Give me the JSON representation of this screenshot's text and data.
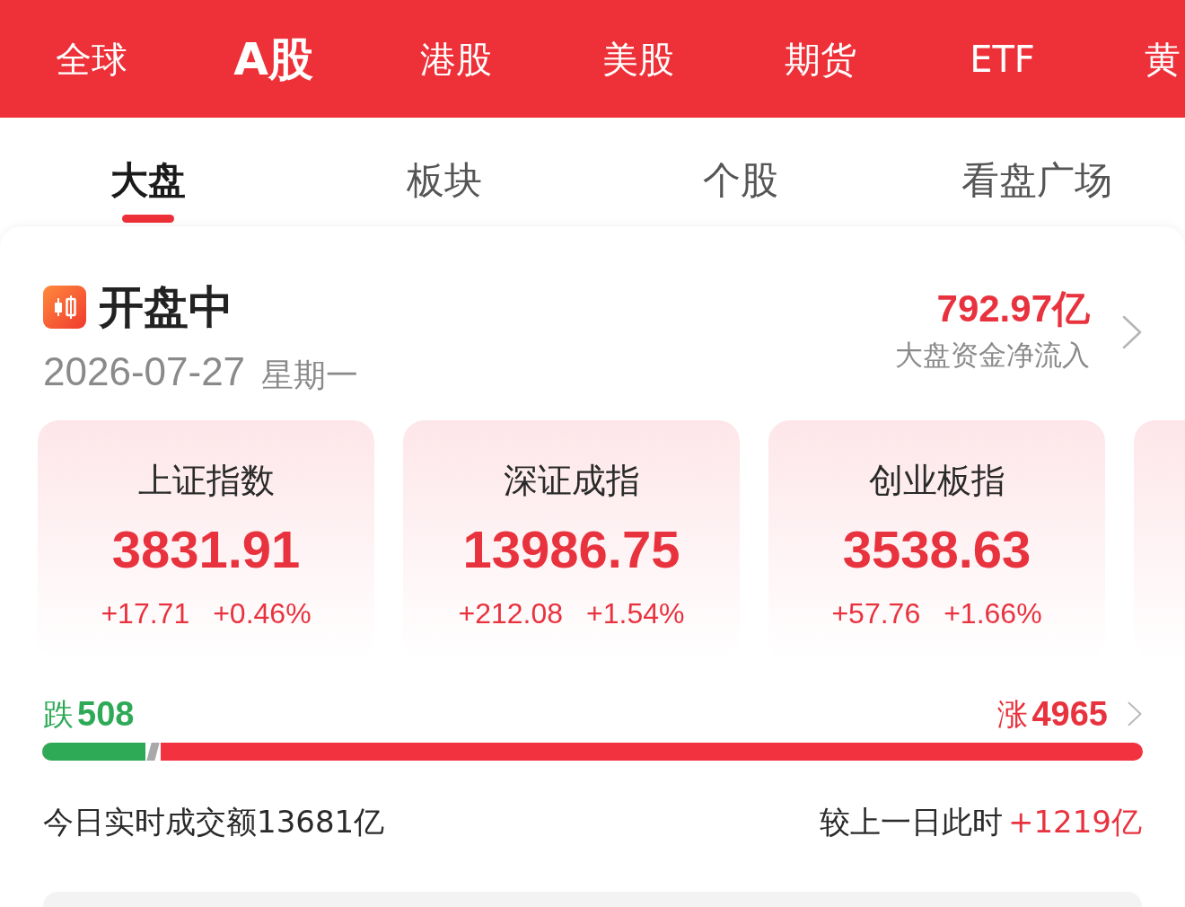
{
  "market_tabs": [
    {
      "label": "全球",
      "selected": false
    },
    {
      "label": "A股",
      "selected": true
    },
    {
      "label": "港股",
      "selected": false
    },
    {
      "label": "美股",
      "selected": false
    },
    {
      "label": "期货",
      "selected": false
    },
    {
      "label": "ETF",
      "selected": false
    },
    {
      "label": "黄",
      "selected": false
    }
  ],
  "view_tabs": [
    {
      "label": "大盘",
      "selected": true
    },
    {
      "label": "板块",
      "selected": false
    },
    {
      "label": "个股",
      "selected": false
    },
    {
      "label": "看盘广场",
      "selected": false
    }
  ],
  "session": {
    "status": "开盘中",
    "date": "2026-07-27",
    "weekday": "星期一"
  },
  "net_inflow": {
    "value": "792.97亿",
    "label": "大盘资金净流入"
  },
  "indices": [
    {
      "name": "上证指数",
      "value": "3831.91",
      "change": "+17.71",
      "change_pct": "+0.46%"
    },
    {
      "name": "深证成指",
      "value": "13986.75",
      "change": "+212.08",
      "change_pct": "+1.54%"
    },
    {
      "name": "创业板指",
      "value": "3538.63",
      "change": "+57.76",
      "change_pct": "+1.66%"
    }
  ],
  "breadth": {
    "down_label": "跌",
    "down_count": "508",
    "up_label": "涨",
    "up_count": "4965",
    "level": 0.108
  },
  "turnover": {
    "text": "今日实时成交额13681亿",
    "compare_label": "较上一日此时",
    "compare_value": "+1219亿"
  }
}
